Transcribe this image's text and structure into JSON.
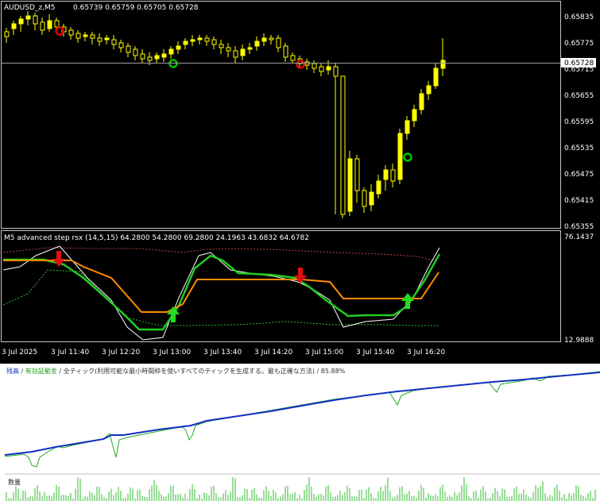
{
  "chart": {
    "symbol_label": "AUDUSD_z,M5",
    "ohlc_text": "0.65739 0.65759 0.65705 0.65728",
    "price_axis": [
      "0.65835",
      "0.65775",
      "0.65715",
      "0.65655",
      "0.65595",
      "0.65535",
      "0.65475",
      "0.65415",
      "0.65355"
    ],
    "current_price": "0.65728",
    "colors": {
      "bull": "#ffff00",
      "bear": "#ffffff",
      "signal_green": "#00c000",
      "signal_red": "#e00000"
    }
  },
  "indicator": {
    "title": "M5 advanced step rsx (14,5,15) 64.2800 54.2800 69.2800 24.1963 43.6832 64.6782",
    "axis_top": "76.1437",
    "axis_bottom": "12.9888",
    "colors": {
      "orange": "#ff8c00",
      "green": "#22cc22",
      "white": "#ffffff",
      "dotted_red": "#c04040",
      "dotted_green": "#30c030"
    }
  },
  "time_axis": [
    "3 Jul 2025",
    "3 Jul 11:40",
    "3 Jul 12:20",
    "3 Jul 13:00",
    "3 Jul 13:40",
    "3 Jul 14:20",
    "3 Jul 15:00",
    "3 Jul 15:40",
    "3 Jul 16:20"
  ],
  "tester": {
    "balance_label": "残高",
    "equity_label": "有効証拠金",
    "mode_text": "全ティック(利用可能な最小時間枠を使いすべてのティックを生成する。最も正確な方法)",
    "progress": "85.88%",
    "volume_label": "数量",
    "colors": {
      "balance": "#1030c0",
      "equity": "#22aa22"
    }
  }
}
